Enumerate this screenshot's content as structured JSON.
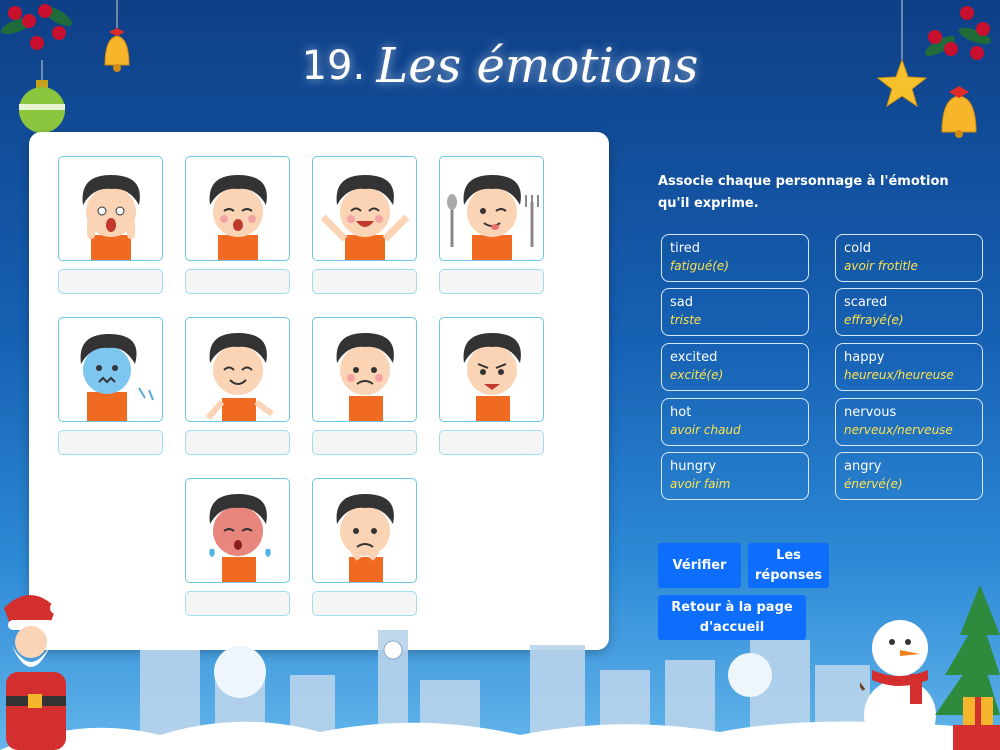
{
  "header": {
    "number": "19.",
    "title": "Les émotions"
  },
  "instructions": "Associe chaque personnage à l'émotion qu'il exprime.",
  "emotions_left": [
    {
      "en": "tired",
      "fr": "fatigué(e)"
    },
    {
      "en": "sad",
      "fr": "triste"
    },
    {
      "en": "excited",
      "fr": "excité(e)"
    },
    {
      "en": "hot",
      "fr": "avoir chaud"
    },
    {
      "en": "hungry",
      "fr": "avoir faim"
    }
  ],
  "emotions_right": [
    {
      "en": "cold",
      "fr": "avoir frotitle"
    },
    {
      "en": "scared",
      "fr": "effrayé(e)"
    },
    {
      "en": "happy",
      "fr": "heureux/heureuse"
    },
    {
      "en": "nervous",
      "fr": "nerveux/nerveuse"
    },
    {
      "en": "angry",
      "fr": "énervé(e)"
    }
  ],
  "buttons": {
    "check": "Vérifier",
    "answers": "Les réponses",
    "home": "Retour à la page d'accueil"
  },
  "characters": [
    "scared-face",
    "tired-face",
    "excited-face",
    "hungry-face",
    "cold-face",
    "happy-face",
    "nervous-face",
    "angry-face",
    "hot-face",
    "sad-face"
  ],
  "colors": {
    "button": "#0d6efd",
    "french_text": "#ffe14d",
    "card_border": "#6cc9e6"
  }
}
